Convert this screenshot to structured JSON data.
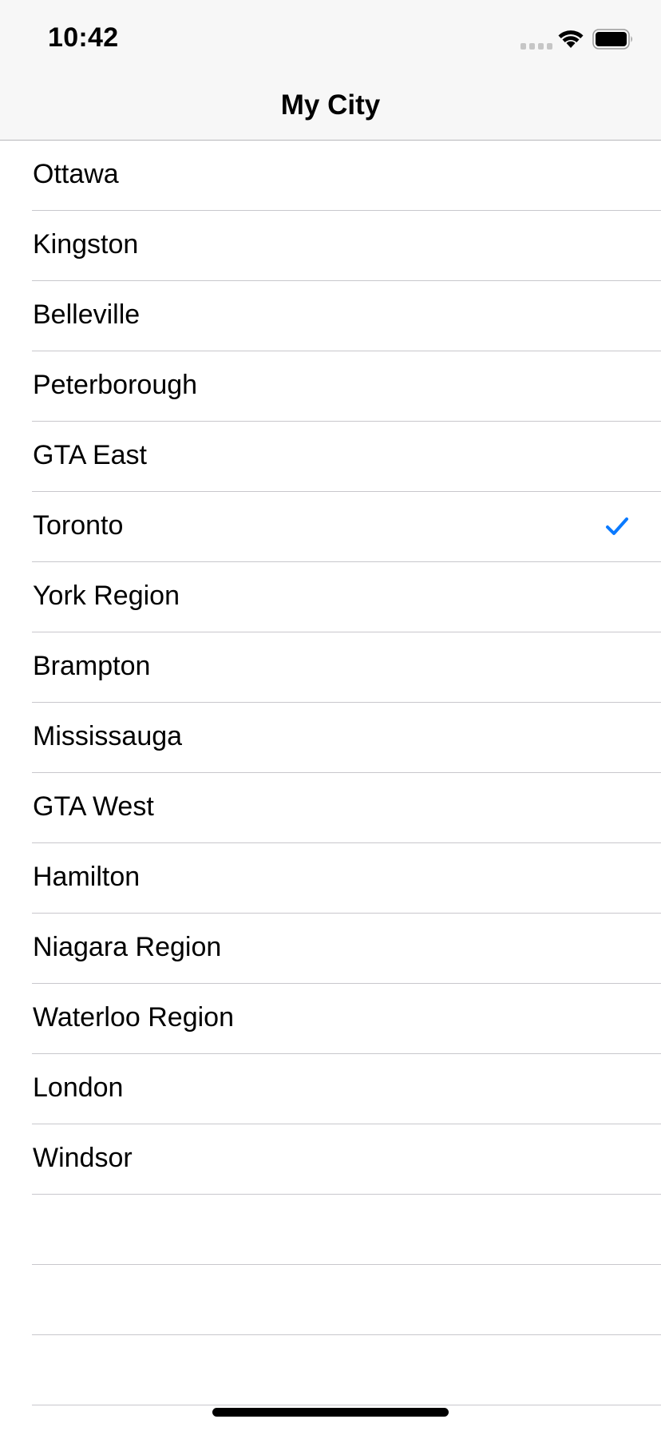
{
  "status_bar": {
    "time": "10:42",
    "icons": [
      "signal-icon",
      "wifi-icon",
      "battery-icon"
    ]
  },
  "nav": {
    "title": "My City"
  },
  "accent_color": "#0a7aff",
  "cities": [
    {
      "label": "Ottawa",
      "selected": false
    },
    {
      "label": "Kingston",
      "selected": false
    },
    {
      "label": "Belleville",
      "selected": false
    },
    {
      "label": "Peterborough",
      "selected": false
    },
    {
      "label": "GTA East",
      "selected": false
    },
    {
      "label": "Toronto",
      "selected": true
    },
    {
      "label": "York Region",
      "selected": false
    },
    {
      "label": "Brampton",
      "selected": false
    },
    {
      "label": "Mississauga",
      "selected": false
    },
    {
      "label": "GTA West",
      "selected": false
    },
    {
      "label": "Hamilton",
      "selected": false
    },
    {
      "label": "Niagara Region",
      "selected": false
    },
    {
      "label": "Waterloo Region",
      "selected": false
    },
    {
      "label": "London",
      "selected": false
    },
    {
      "label": "Windsor",
      "selected": false
    }
  ]
}
